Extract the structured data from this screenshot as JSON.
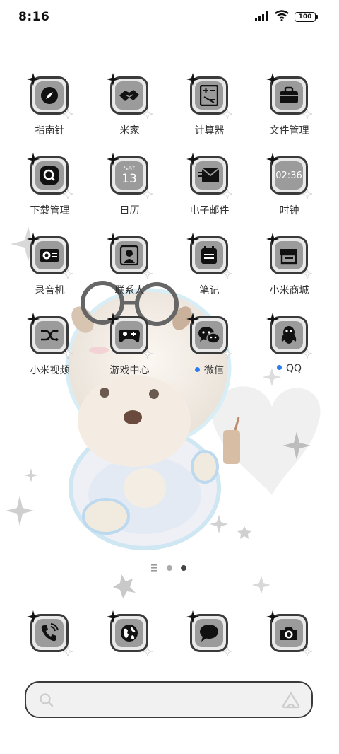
{
  "status_bar": {
    "time": "8:16",
    "battery": "100",
    "icons": [
      "signal-icon",
      "wifi-icon",
      "battery-icon"
    ]
  },
  "apps": [
    {
      "label": "指南针",
      "icon": "compass-icon"
    },
    {
      "label": "米家",
      "icon": "smart-home-icon"
    },
    {
      "label": "计算器",
      "icon": "calculator-icon"
    },
    {
      "label": "文件管理",
      "icon": "briefcase-icon"
    },
    {
      "label": "下载管理",
      "icon": "download-icon"
    },
    {
      "label": "日历",
      "icon": "calendar-icon",
      "day": "Sat",
      "date": "13"
    },
    {
      "label": "电子邮件",
      "icon": "mail-icon"
    },
    {
      "label": "时钟",
      "icon": "clock-icon",
      "clock_text": "02:36"
    },
    {
      "label": "录音机",
      "icon": "recorder-icon"
    },
    {
      "label": "联系人",
      "icon": "contacts-icon"
    },
    {
      "label": "笔记",
      "icon": "notes-icon"
    },
    {
      "label": "小米商城",
      "icon": "store-icon"
    },
    {
      "label": "小米视频",
      "icon": "video-icon"
    },
    {
      "label": "游戏中心",
      "icon": "gamepad-icon"
    },
    {
      "label": "微信",
      "icon": "wechat-icon",
      "badge": true
    },
    {
      "label": "QQ",
      "icon": "qq-icon",
      "badge": true
    }
  ],
  "dock": [
    {
      "icon": "phone-icon"
    },
    {
      "icon": "browser-icon"
    },
    {
      "icon": "messages-icon"
    },
    {
      "icon": "camera-icon"
    }
  ],
  "page_indicator": {
    "pages": 3,
    "active": 2
  },
  "search": {
    "icons": [
      "search-icon",
      "assistant-icon"
    ]
  },
  "colors": {
    "icon_frame": "#3a3a3a",
    "icon_tile": "#e9e9e9",
    "icon_inner": "#9b9b9b",
    "badge": "#2b7cf2"
  }
}
